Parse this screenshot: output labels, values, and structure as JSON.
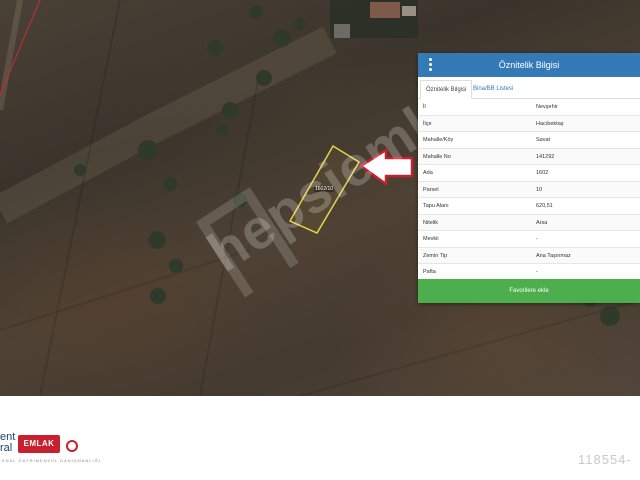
{
  "map": {
    "parcel_label": "1602/10",
    "watermark": "hepsiemlak"
  },
  "panel": {
    "title": "Öznitelik Bilgisi",
    "tabs": [
      {
        "label": "Öznitelik Bilgisi",
        "active": true
      },
      {
        "label": "Bina/BB Listesi",
        "active": false
      }
    ],
    "rows": [
      {
        "key": "İl",
        "value": "Nevşehir"
      },
      {
        "key": "İlçe",
        "value": "Hacıbektaş"
      },
      {
        "key": "Mahalle/Köy",
        "value": "Savat"
      },
      {
        "key": "Mahalle No",
        "value": "141292"
      },
      {
        "key": "Ada",
        "value": "1602"
      },
      {
        "key": "Parsel",
        "value": "10"
      },
      {
        "key": "Tapu Alanı",
        "value": "620,51"
      },
      {
        "key": "Nitelik",
        "value": "Arsa"
      },
      {
        "key": "Mevkii",
        "value": "-"
      },
      {
        "key": "Zemin Tip",
        "value": "Ana Taşınmaz"
      },
      {
        "key": "Pafta",
        "value": "-"
      }
    ],
    "favorite_button": "Favorilere ekle"
  },
  "footer": {
    "brand_line1": "ent",
    "brand_line2": "ral",
    "badge": "EMLAK",
    "tagline": "ENAL GAYRİMENKUL DANIŞMANLIĞI",
    "listing_number": "118554-"
  },
  "colors": {
    "header": "#337ab7",
    "button": "#4cae4c",
    "parcel_outline": "#e6d24a",
    "arrow": "#c8202e",
    "brand_red": "#c8202e",
    "brand_blue": "#16456e"
  }
}
